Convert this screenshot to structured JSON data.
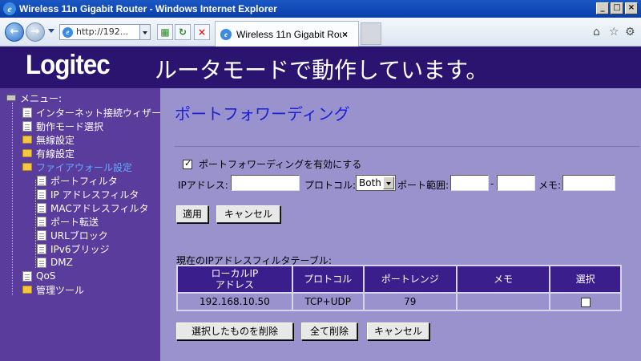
{
  "browser": {
    "window_title": "Wireless 11n Gigabit Router - Windows Internet Explorer",
    "address": "http://192...",
    "tab_title": "Wireless 11n Gigabit Router",
    "window_buttons": [
      "_",
      "□",
      "×"
    ]
  },
  "header": {
    "logo": "Logitec",
    "mode_text": "ルータモードで動作しています。"
  },
  "sidebar": {
    "items": [
      {
        "label": "メニュー:",
        "icon": "network-icon"
      },
      {
        "label": "インターネット接続ウィザード",
        "icon": "page-icon"
      },
      {
        "label": "動作モード選択",
        "icon": "page-icon"
      },
      {
        "label": "無線設定",
        "icon": "folder-icon"
      },
      {
        "label": "有線設定",
        "icon": "folder-icon"
      },
      {
        "label": "ファイアウォール設定",
        "icon": "folder-open-icon"
      },
      {
        "label": "ポートフィルタ",
        "icon": "page-icon"
      },
      {
        "label": "IP アドレスフィルタ",
        "icon": "page-icon"
      },
      {
        "label": "MACアドレスフィルタ",
        "icon": "page-icon"
      },
      {
        "label": "ポート転送",
        "icon": "page-icon"
      },
      {
        "label": "URLブロック",
        "icon": "page-icon"
      },
      {
        "label": "IPv6ブリッジ",
        "icon": "page-icon"
      },
      {
        "label": "DMZ",
        "icon": "page-icon"
      },
      {
        "label": "QoS",
        "icon": "page-icon"
      },
      {
        "label": "管理ツール",
        "icon": "folder-icon"
      }
    ]
  },
  "main": {
    "title": "ポートフォワーディング",
    "enable_label": "ポートフォワーディングを有効にする",
    "enable_checked": true,
    "form": {
      "ip_label": "IPアドレス:",
      "ip_value": "",
      "protocol_label": "プロトコル:",
      "protocol_value": "Both",
      "port_range_label": "ポート範囲:",
      "port_from": "",
      "port_sep": "-",
      "port_to": "",
      "memo_label": "メモ:",
      "memo_value": ""
    },
    "apply_button": "適用",
    "cancel_button": "キャンセル",
    "table_caption": "現在のIPアドレスフィルタテーブル:",
    "table": {
      "headers": [
        "ローカルIP\nアドレス",
        "プロトコル",
        "ポートレンジ",
        "メモ",
        "選択"
      ],
      "rows": [
        {
          "ip": "192.168.10.50",
          "protocol": "TCP+UDP",
          "port_range": "79",
          "memo": "",
          "selected": false
        }
      ]
    },
    "delete_selected_button": "選択したものを削除",
    "delete_all_button": "全て削除",
    "cancel2_button": "キャンセル"
  },
  "colors": {
    "banner": "#2a1470",
    "sidebar": "#5a3c9c",
    "content": "#9a92cc",
    "table_header": "#3a1e8c",
    "title_text": "#1a22d8"
  }
}
